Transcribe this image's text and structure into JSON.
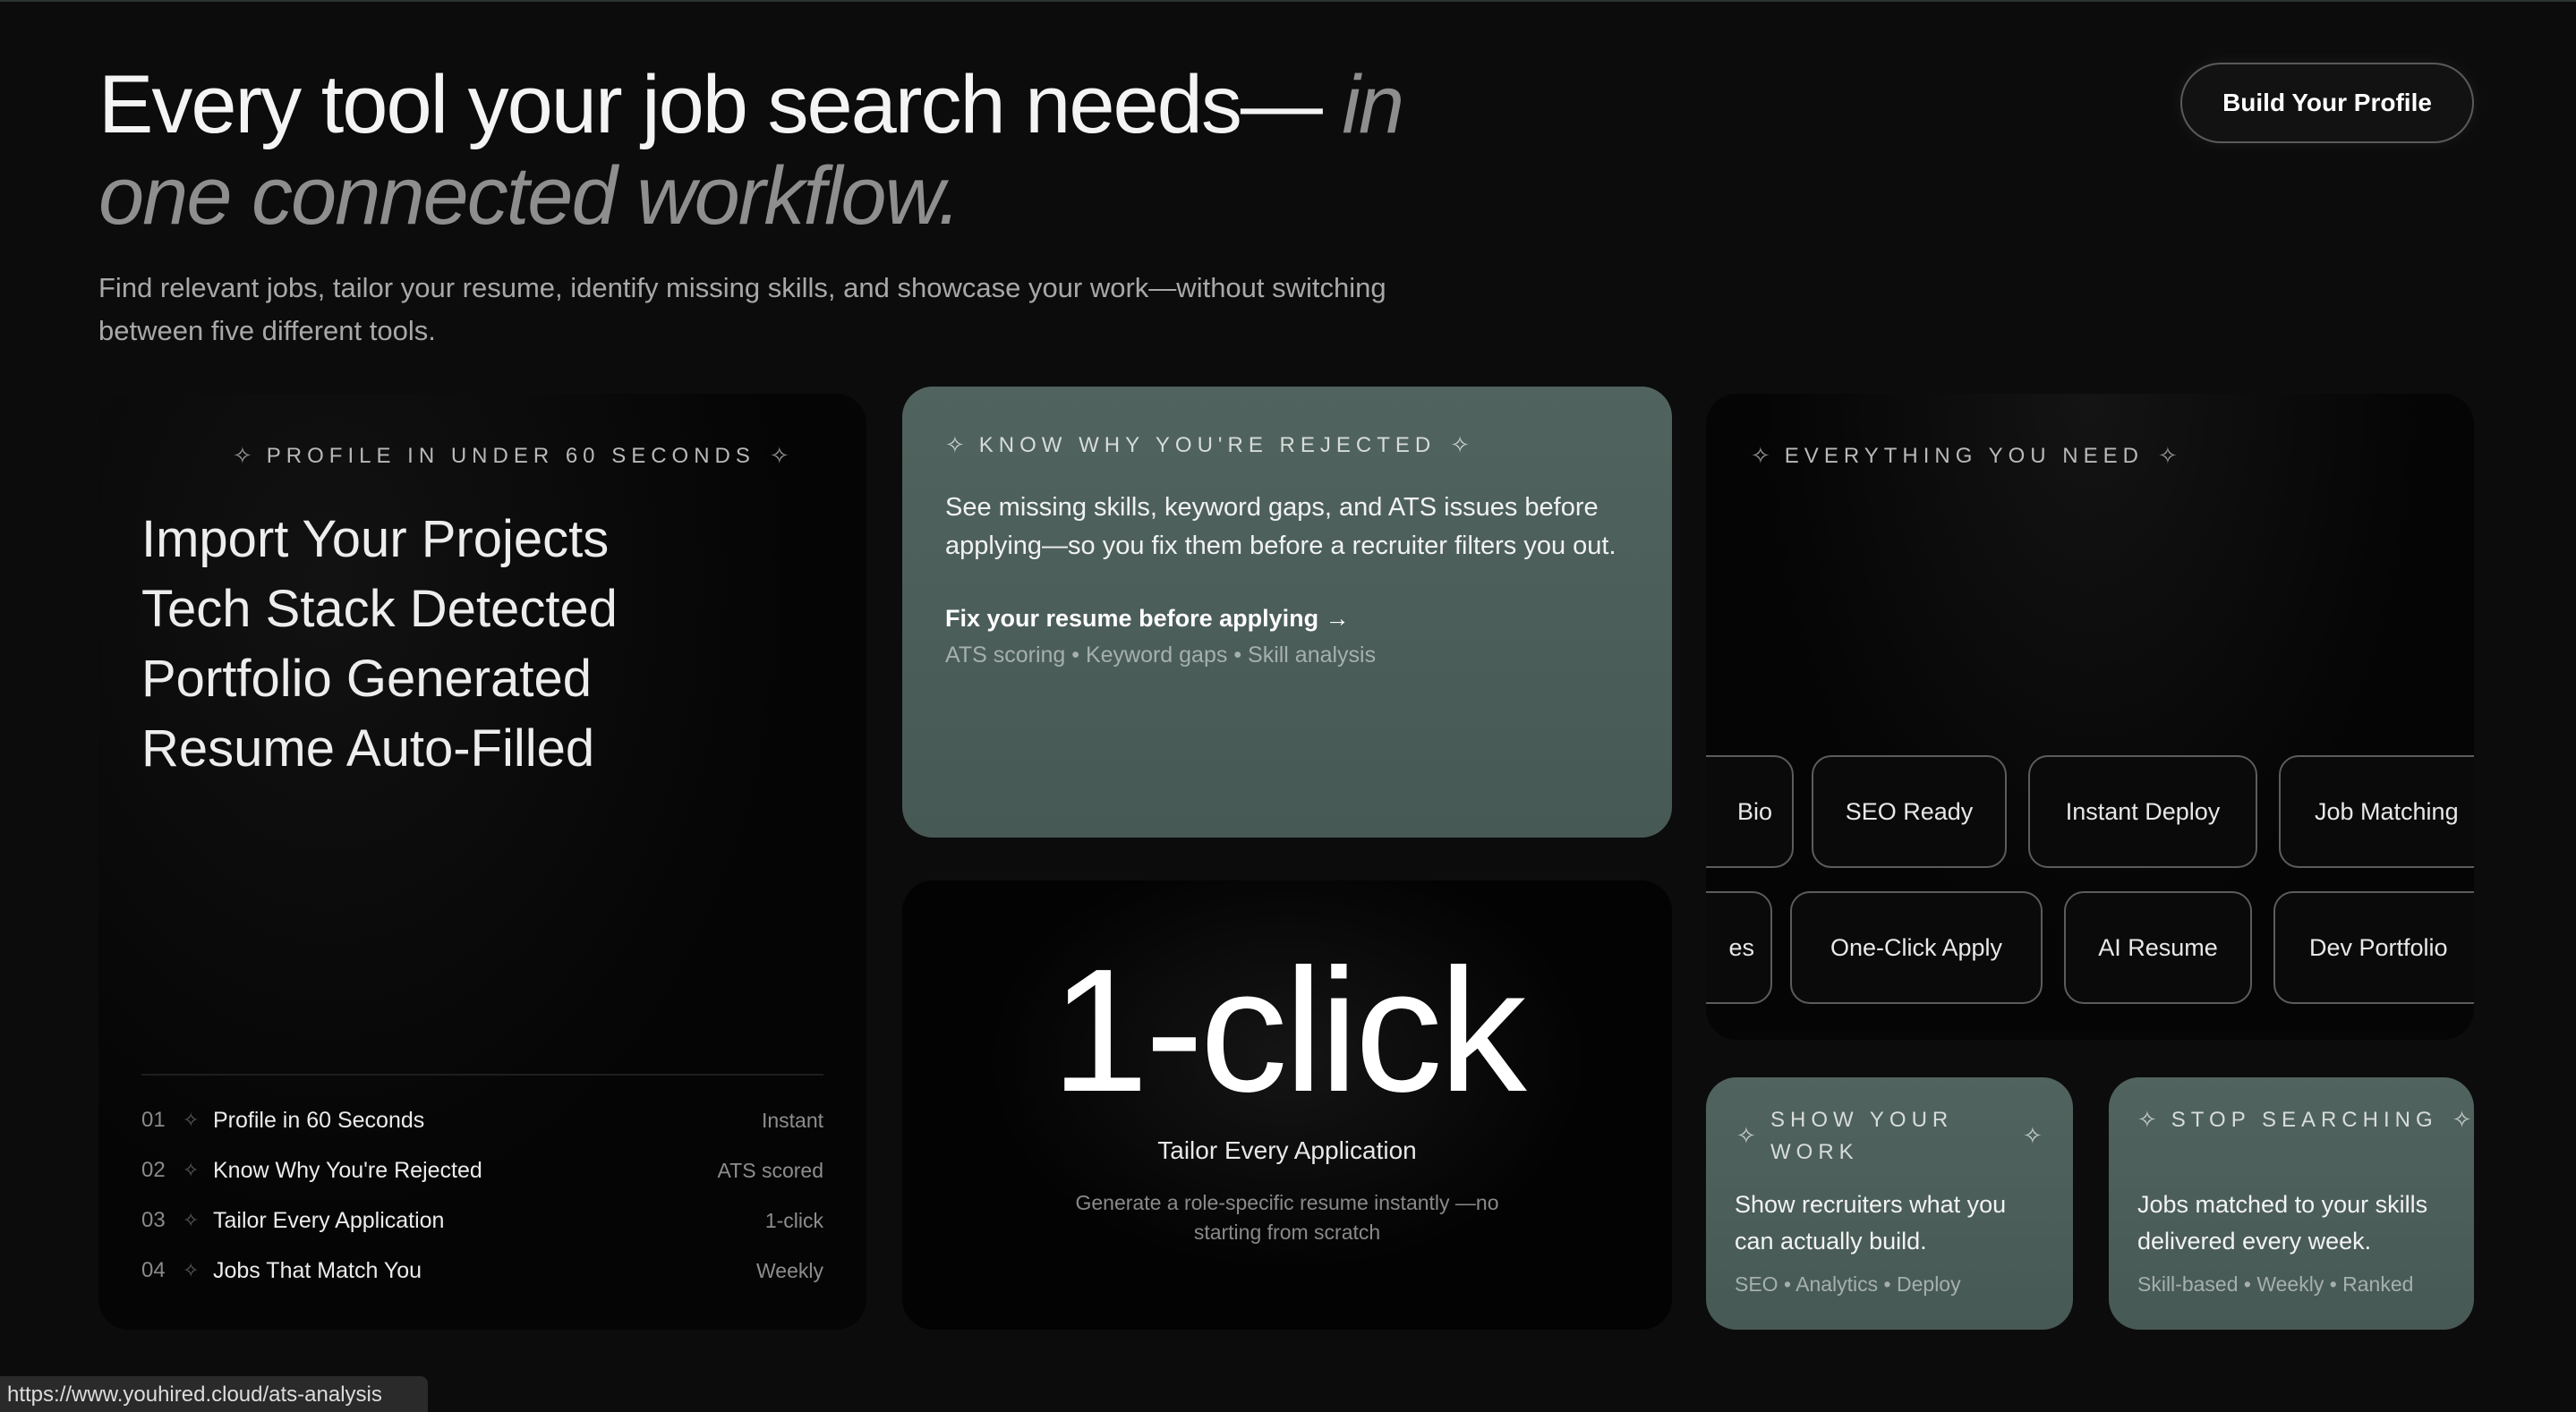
{
  "header": {
    "title_main": "Every tool your job search needs— ",
    "title_accent": "in one connected workflow.",
    "subtitle": "Find relevant jobs, tailor your resume, identify missing skills, and showcase your work—without switching between five different tools.",
    "cta_label": "Build Your Profile"
  },
  "profile_card": {
    "label": "Profile in under 60 seconds",
    "steps": [
      "Import Your Projects",
      "Tech Stack Detected",
      "Portfolio Generated",
      "Resume Auto-Filled"
    ],
    "features": [
      {
        "num": "01",
        "name": "Profile in 60 Seconds",
        "tag": "Instant"
      },
      {
        "num": "02",
        "name": "Know Why You're Rejected",
        "tag": "ATS scored"
      },
      {
        "num": "03",
        "name": "Tailor Every Application",
        "tag": "1-click"
      },
      {
        "num": "04",
        "name": "Jobs That Match You",
        "tag": "Weekly"
      }
    ]
  },
  "rejected_card": {
    "label": "Know why you're rejected",
    "body": "See missing skills, keyword gaps, and ATS issues before applying—so you fix them before a recruiter filters you out.",
    "link": "Fix your resume before applying →",
    "meta": "ATS scoring • Keyword gaps • Skill analysis"
  },
  "click_card": {
    "headline": "1-click",
    "subtitle": "Tailor Every Application",
    "description": "Generate a role-specific resume instantly —no starting from scratch"
  },
  "everything_card": {
    "label": "Everything you need",
    "row1": [
      "Bio",
      "SEO Ready",
      "Instant Deploy",
      "Job Matching"
    ],
    "row2": [
      "es",
      "One-Click Apply",
      "AI Resume",
      "Dev Portfolio"
    ]
  },
  "work_card": {
    "label": "Show your work",
    "body": "Show recruiters what you can actually build.",
    "meta": "SEO • Analytics • Deploy"
  },
  "search_card": {
    "label": "Stop searching",
    "body": "Jobs matched to your skills delivered every week.",
    "meta": "Skill-based • Weekly • Ranked"
  },
  "status_url": "https://www.youhired.cloud/ats-analysis",
  "colors": {
    "background": "#0c0c0c",
    "card_green": "#4a5c58",
    "card_dark": "#050505",
    "text_muted": "#8e8e8e"
  }
}
